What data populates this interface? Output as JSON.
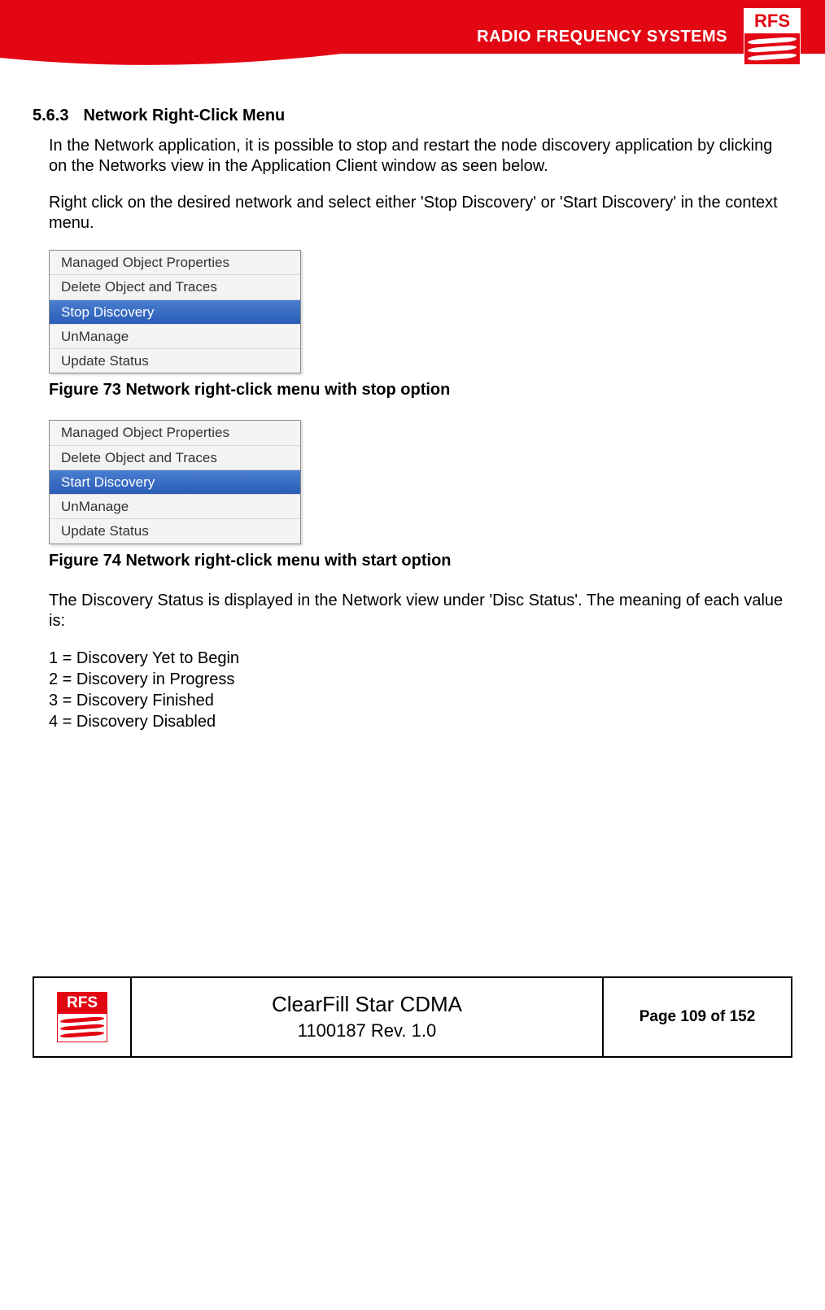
{
  "header": {
    "brand_text": "RADIO FREQUENCY SYSTEMS",
    "logo_text": "RFS"
  },
  "section": {
    "number": "5.6.3",
    "title": "Network Right-Click Menu",
    "para1": "In the Network application, it is possible to stop and restart the node discovery application by clicking on the Networks view in the Application Client window as seen below.",
    "para2": "Right click on the desired network and select either 'Stop Discovery' or 'Start Discovery' in the context menu."
  },
  "figure73": {
    "caption": "Figure 73 Network right-click menu with stop option",
    "menu": {
      "items": [
        {
          "label": "Managed Object Properties",
          "selected": false
        },
        {
          "label": "Delete Object and Traces",
          "selected": false
        },
        {
          "label": "Stop Discovery",
          "selected": true
        },
        {
          "label": "UnManage",
          "selected": false
        },
        {
          "label": "Update Status",
          "selected": false
        }
      ]
    }
  },
  "figure74": {
    "caption": "Figure 74 Network right-click menu with start option",
    "menu": {
      "items": [
        {
          "label": "Managed Object Properties",
          "selected": false
        },
        {
          "label": "Delete Object and Traces",
          "selected": false
        },
        {
          "label": "Start Discovery",
          "selected": true
        },
        {
          "label": "UnManage",
          "selected": false
        },
        {
          "label": "Update Status",
          "selected": false
        }
      ]
    }
  },
  "status_intro": "The Discovery Status is displayed in the Network view under 'Disc Status'. The meaning of each value is:",
  "status_values": [
    "1 = Discovery Yet to Begin",
    "2 = Discovery in Progress",
    "3 = Discovery Finished",
    "4 = Discovery Disabled"
  ],
  "footer": {
    "logo_text": "RFS",
    "title": "ClearFill Star CDMA",
    "subtitle": "1100187 Rev. 1.0",
    "page": "Page 109 of 152"
  }
}
